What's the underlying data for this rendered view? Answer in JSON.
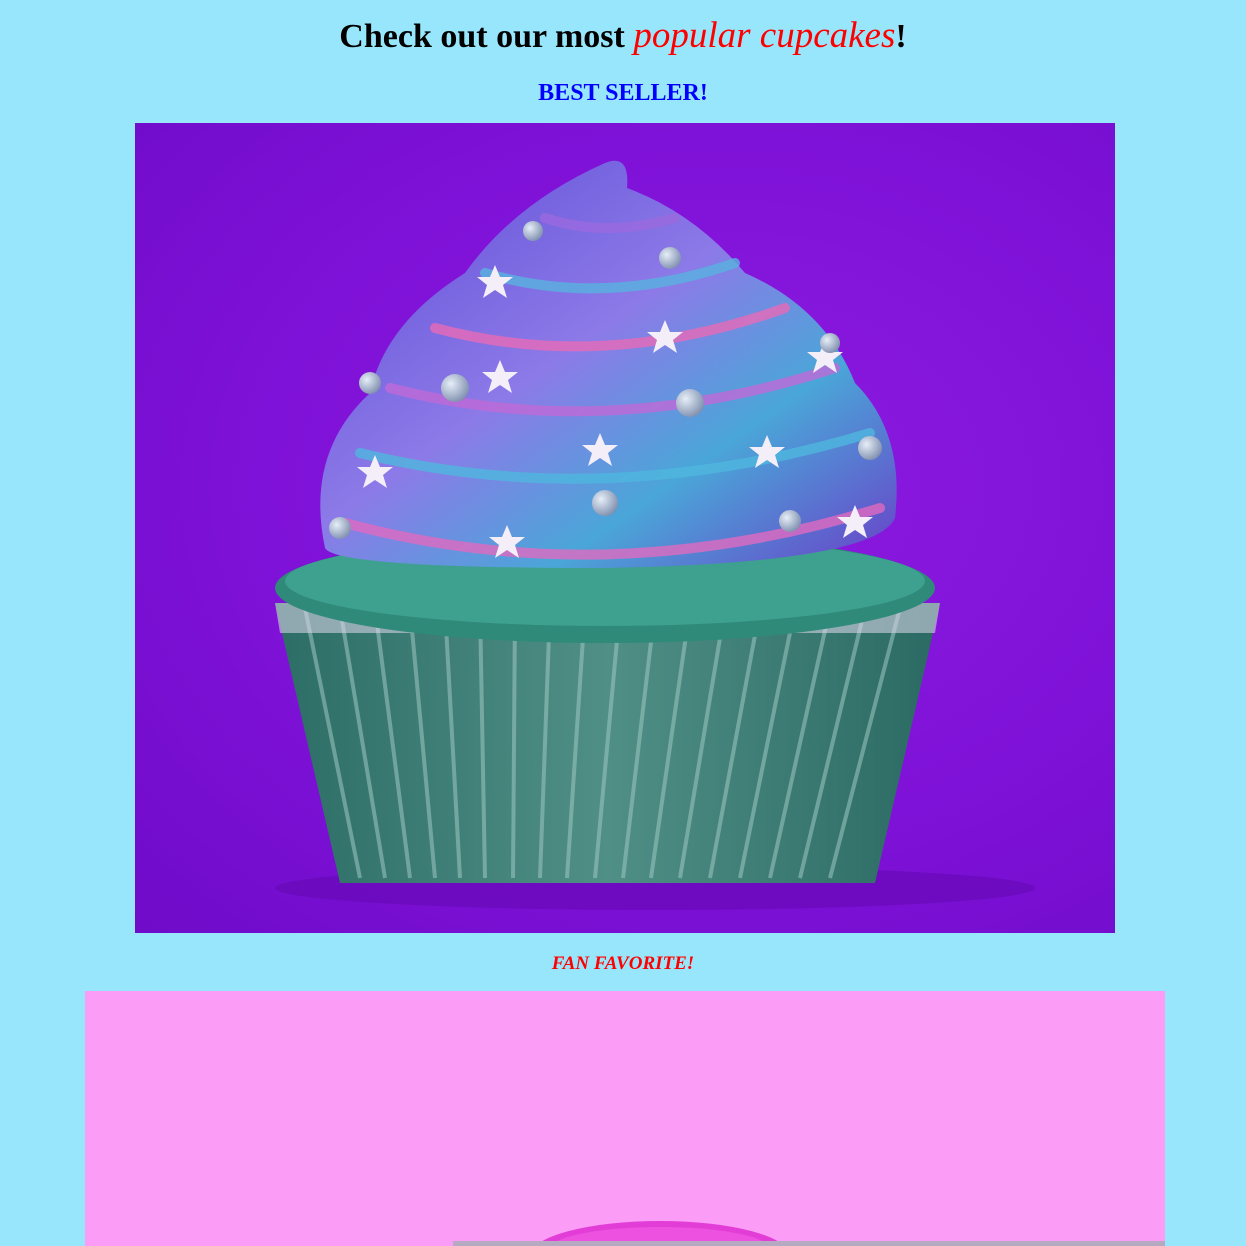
{
  "header": {
    "headline_prefix": "Check out our most ",
    "headline_highlight": "popular cupcakes",
    "headline_suffix": "!"
  },
  "items": [
    {
      "label": "BEST SELLER!",
      "image": "galaxy-cupcake-photo"
    },
    {
      "label": "FAN FAVORITE!",
      "image": "pink-cupcake-photo"
    }
  ],
  "colors": {
    "page_background": "#98e6fb",
    "highlight": "#ff0000",
    "best_seller_label": "#0000ff",
    "photo1_background": "#8d1ae0",
    "photo2_background": "#fb9cf6"
  }
}
